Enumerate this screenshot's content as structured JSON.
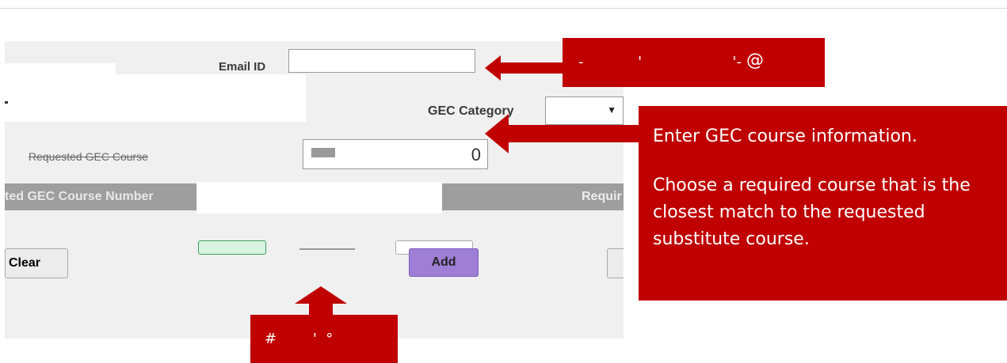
{
  "form": {
    "email_label": "Email ID",
    "gec_category_label": "GEC Category",
    "course_row_label": "Requested GEC Course",
    "course_number_label": "ted GEC Course Number",
    "required_label": "Requir",
    "clear_label": "Clear",
    "add_label": "Add"
  },
  "callouts": {
    "top_text": "-            '                    '-          ",
    "top_symbol": "@",
    "main_line1": "Enter GEC course information.",
    "main_line2": "Choose a required course that is the closest match to the requested substitute course.",
    "bottom_text": "#        '  °"
  },
  "colors": {
    "callout": "#c00000",
    "add_button": "#9f7fd6",
    "green_button": "#d8f3e0"
  }
}
